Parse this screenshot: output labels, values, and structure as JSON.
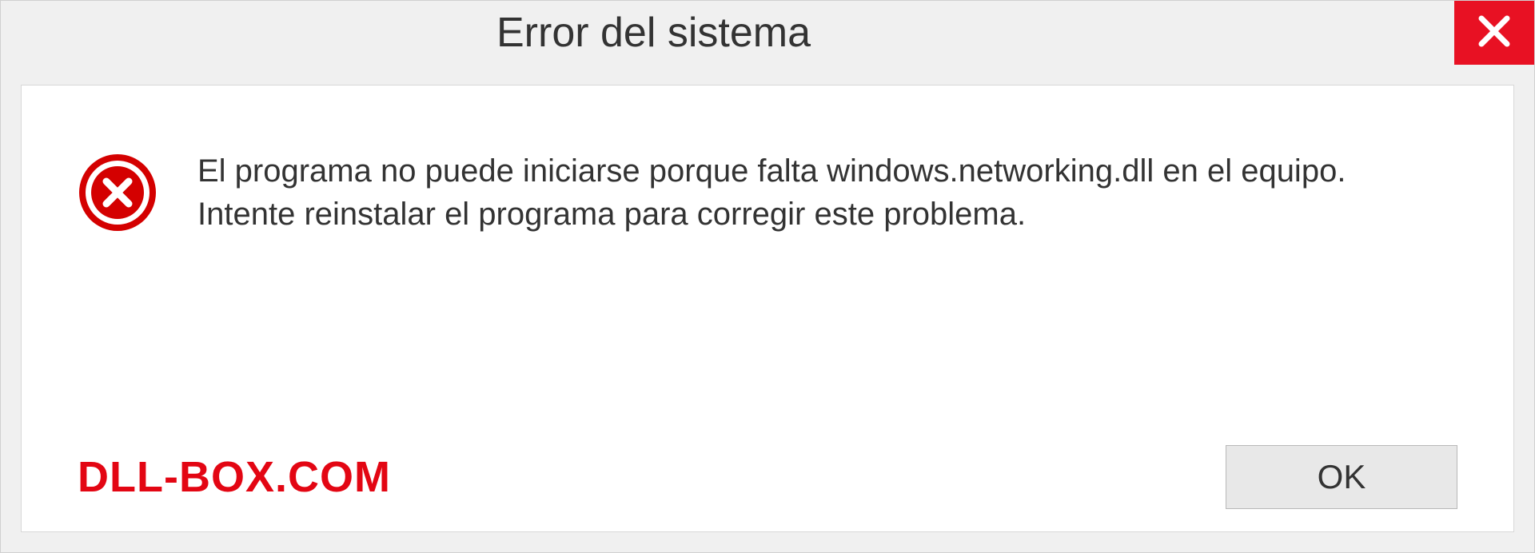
{
  "dialog": {
    "title": "Error del sistema",
    "message": "El programa no puede iniciarse porque falta windows.networking.dll en el equipo. Intente reinstalar el programa para corregir este problema.",
    "ok_label": "OK"
  },
  "watermark": {
    "text": "DLL-BOX.COM"
  },
  "colors": {
    "close_bg": "#e81123",
    "error_icon": "#d40000",
    "watermark": "#e30613"
  }
}
